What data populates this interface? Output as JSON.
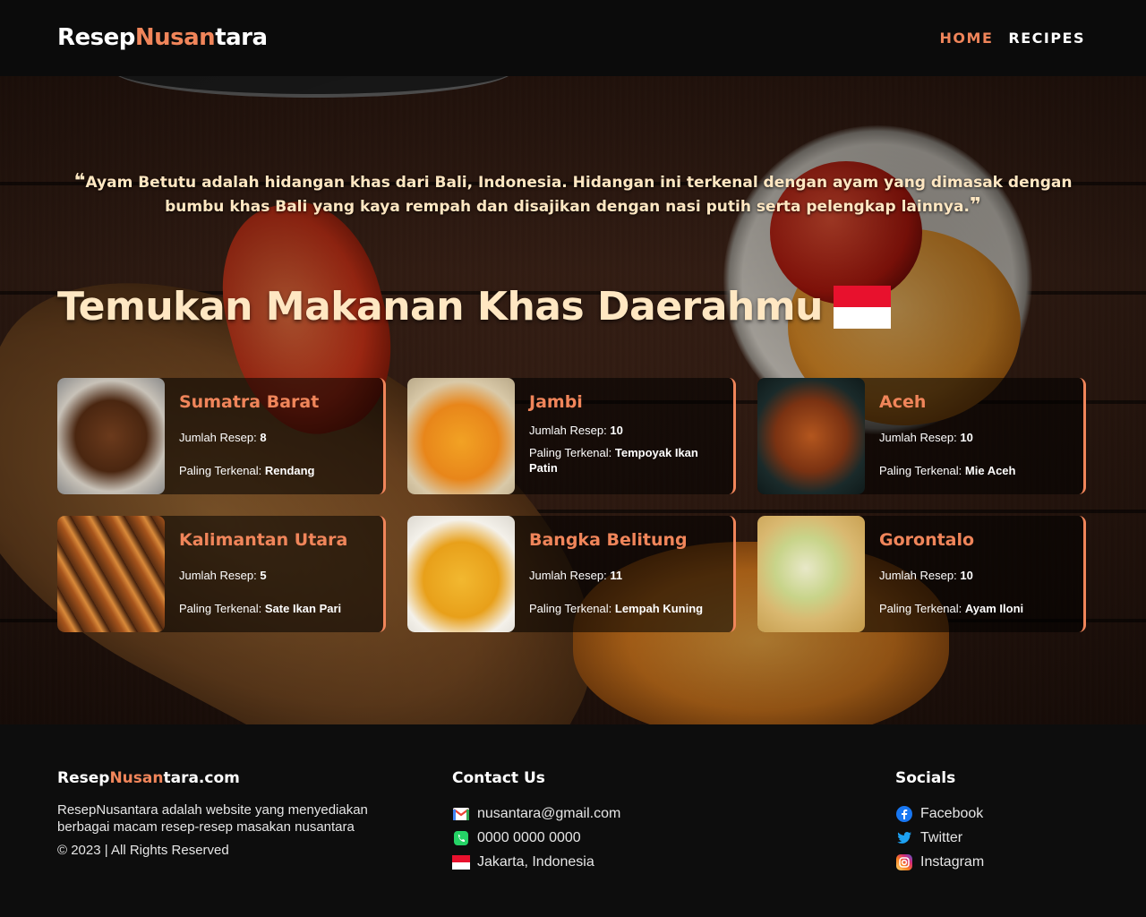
{
  "header": {
    "logo_part1": "Resep",
    "logo_part2": "Nusan",
    "logo_part3": "tara",
    "nav": [
      {
        "label": "HOME",
        "active": true
      },
      {
        "label": "RECIPES",
        "active": false
      }
    ],
    "accent_color": "#f0855a"
  },
  "hero": {
    "quote": "Ayam Betutu adalah hidangan khas dari Bali, Indonesia. Hidangan ini terkenal dengan ayam yang dimasak dengan bumbu khas Bali yang kaya rempah dan disajikan dengan nasi putih serta pelengkap lainnya.",
    "quote_open": "❝",
    "quote_close": "❞",
    "title": "Temukan Makanan Khas Daerahmu",
    "flag_icon": "indonesia-flag-icon"
  },
  "regions": [
    {
      "name": "Sumatra Barat",
      "count_label": "Jumlah Resep:",
      "count": "8",
      "famous_label": "Paling Terkenal:",
      "famous": "Rendang",
      "image": "rendang-photo"
    },
    {
      "name": "Jambi",
      "count_label": "Jumlah Resep:",
      "count": "10",
      "famous_label": "Paling Terkenal:",
      "famous": "Tempoyak Ikan Patin",
      "image": "tempoyak-photo"
    },
    {
      "name": "Aceh",
      "count_label": "Jumlah Resep:",
      "count": "10",
      "famous_label": "Paling Terkenal:",
      "famous": "Mie Aceh",
      "image": "mie-aceh-photo"
    },
    {
      "name": "Kalimantan Utara",
      "count_label": "Jumlah Resep:",
      "count": "5",
      "famous_label": "Paling Terkenal:",
      "famous": "Sate Ikan Pari",
      "image": "sate-ikan-pari-photo"
    },
    {
      "name": "Bangka Belitung",
      "count_label": "Jumlah Resep:",
      "count": "11",
      "famous_label": "Paling Terkenal:",
      "famous": "Lempah Kuning",
      "image": "lempah-kuning-photo"
    },
    {
      "name": "Gorontalo",
      "count_label": "Jumlah Resep:",
      "count": "10",
      "famous_label": "Paling Terkenal:",
      "famous": "Ayam Iloni",
      "image": "ayam-iloni-photo"
    }
  ],
  "footer": {
    "brand_part1": "Resep",
    "brand_part2": "Nusan",
    "brand_part3": "tara.com",
    "description": "ResepNusantara adalah website yang menyediakan berbagai macam resep-resep masakan nusantara",
    "copyright": "© 2023 | All Rights Reserved",
    "contact_title": "Contact Us",
    "contacts": [
      {
        "icon": "gmail-icon",
        "text": "nusantara@gmail.com"
      },
      {
        "icon": "whatsapp-icon",
        "text": "0000 0000 0000"
      },
      {
        "icon": "indonesia-flag-icon",
        "text": "Jakarta, Indonesia"
      }
    ],
    "socials_title": "Socials",
    "socials": [
      {
        "icon": "facebook-icon",
        "text": "Facebook"
      },
      {
        "icon": "twitter-icon",
        "text": "Twitter"
      },
      {
        "icon": "instagram-icon",
        "text": "Instagram"
      }
    ]
  }
}
